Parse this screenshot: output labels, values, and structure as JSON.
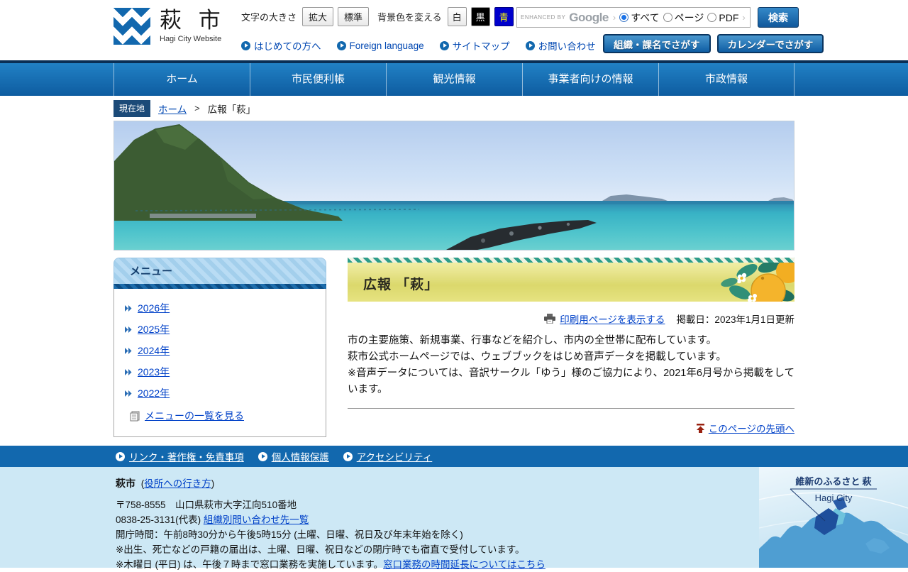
{
  "colors": {
    "primary_blue": "#1268ae",
    "nav_gradient_top": "#2181c5",
    "nav_gradient_bottom": "#0e5ca0",
    "link_blue": "#0041c8",
    "footer_bg": "#cde8f5",
    "title_bar_yellow": "#dbd86c",
    "stripe_teal": "#2e9c8a",
    "badge_navy": "#1b4a78",
    "back_to_top_red": "#992211",
    "bg_button_blue": "#0000cc",
    "bg_button_blue_text": "#ffff00"
  },
  "header": {
    "site_name": "萩 市",
    "site_subtitle": "Hagi City Website",
    "text_size_label": "文字の大きさ",
    "text_size_buttons": [
      "拡大",
      "標準"
    ],
    "bg_color_label": "背景色を変える",
    "bg_color_buttons": [
      "白",
      "黒",
      "青"
    ],
    "quick_links": [
      "はじめての方へ",
      "Foreign language",
      "サイトマップ",
      "お問い合わせ"
    ],
    "search": {
      "enhanced_by": "ENHANCED BY",
      "google_logo": "Google",
      "chevron": "›",
      "radios": [
        {
          "label": "すべて",
          "checked": true
        },
        {
          "label": "ページ",
          "checked": false
        },
        {
          "label": "PDF",
          "checked": false
        }
      ],
      "search_button": "検索",
      "org_button": "組織・課名でさがす",
      "calendar_button": "カレンダーでさがす"
    }
  },
  "nav": {
    "items": [
      "ホーム",
      "市民便利帳",
      "観光情報",
      "事業者向けの情報",
      "市政情報"
    ]
  },
  "breadcrumb": {
    "badge": "現在地",
    "home": "ホーム",
    "separator": ">",
    "current": "広報「萩」"
  },
  "sidebar": {
    "title": "メニュー",
    "years": [
      "2026年",
      "2025年",
      "2024年",
      "2023年",
      "2022年"
    ],
    "view_all": "メニューの一覧を見る"
  },
  "main": {
    "title": "広報 「萩」",
    "print_link": "印刷用ページを表示する",
    "date": "掲載日：2023年1月1日更新",
    "paragraphs": [
      "市の主要施策、新規事業、行事などを紹介し、市内の全世帯に配布しています。",
      "萩市公式ホームページでは、ウェブブックをはじめ音声データを掲載しています。",
      "※音声データについては、音訳サークル「ゆう」様のご協力により、2021年6月号から掲載をしています。"
    ],
    "back_to_top": "このページの先頭へ"
  },
  "footer": {
    "links": [
      "リンク・著作権・免責事項",
      "個人情報保護",
      "アクセシビリティ"
    ],
    "city_name": "萩市",
    "directions_prefix": "(",
    "directions_link": "役所への行き方",
    "directions_suffix": ")",
    "address": "〒758-8555　山口県萩市大字江向510番地",
    "phone": "0838-25-3131(代表) ",
    "contact_link": "組織別問い合わせ先一覧",
    "hours": "開庁時間：午前8時30分から午後5時15分 (土曜、日曜、祝日及び年末年始を除く)",
    "note1": "※出生、死亡などの戸籍の届出は、土曜、日曜、祝日などの閉庁時でも宿直で受付しています。",
    "note2": "※木曜日 (平日) は、午後７時まで窓口業務を実施しています。",
    "note2_link": "窓口業務の時間延長についてはこちら",
    "map_label_jp": "維新のふるさと 萩",
    "map_label_en": "Hagi City"
  }
}
